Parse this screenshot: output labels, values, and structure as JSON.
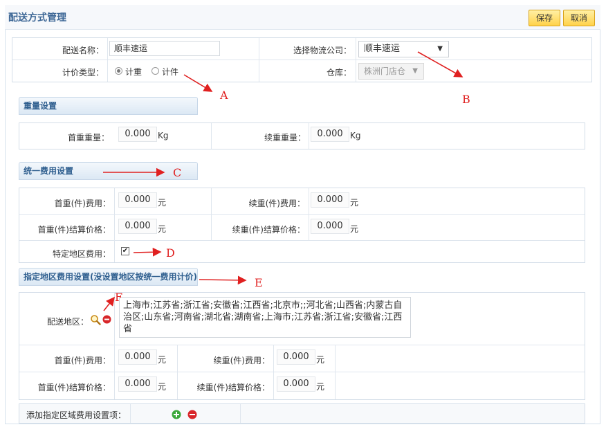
{
  "header": {
    "title": "配送方式管理",
    "save_label": "保存",
    "cancel_label": "取消"
  },
  "basic": {
    "name_label": "配送名称：",
    "name_value": "顺丰速运",
    "company_label": "选择物流公司：",
    "company_value": "顺丰速运",
    "pricing_label": "计价类型：",
    "pricing_options": [
      "计重",
      "计件"
    ],
    "pricing_selected": "计重",
    "warehouse_label": "仓库：",
    "warehouse_value": "株洲门店仓"
  },
  "weight_section": {
    "title": "重量设置",
    "first_label": "首重重量：",
    "first_value": "0.000",
    "first_unit": "Kg",
    "next_label": "续重重量：",
    "next_value": "0.000",
    "next_unit": "Kg"
  },
  "uniform_section": {
    "title": "统一费用设置",
    "first_fee_label": "首重(件)费用：",
    "first_fee_value": "0.000",
    "first_fee_unit": "元",
    "next_fee_label": "续重(件)费用：",
    "next_fee_value": "0.000",
    "next_fee_unit": "元",
    "first_settle_label": "首重(件)结算价格：",
    "first_settle_value": "0.000",
    "first_settle_unit": "元",
    "next_settle_label": "续重(件)结算价格：",
    "next_settle_value": "0.000",
    "next_settle_unit": "元",
    "special_label": "特定地区费用：",
    "special_checked": true
  },
  "region_section": {
    "title": "指定地区费用设置(没设置地区按统一费用计价)",
    "area_label": "配送地区：",
    "area_text": "上海市;江苏省;浙江省;安徽省;江西省;北京市;;河北省;山西省;内蒙古自治区;山东省;河南省;湖北省;湖南省;上海市;江苏省;浙江省;安徽省;江西省",
    "first_fee_label": "首重(件)费用：",
    "first_fee_value": "0.000",
    "first_fee_unit": "元",
    "next_fee_label": "续重(件)费用：",
    "next_fee_value": "0.000",
    "next_fee_unit": "元",
    "first_settle_label": "首重(件)结算价格：",
    "first_settle_value": "0.000",
    "first_settle_unit": "元",
    "next_settle_label": "续重(件)结算价格：",
    "next_settle_value": "0.000",
    "next_settle_unit": "元",
    "add_label": "添加指定区域费用设置项："
  },
  "annotations": {
    "a": "A",
    "b": "B",
    "c": "C",
    "d": "D",
    "e": "E",
    "f": "F"
  },
  "colors": {
    "accent": "#3d6796",
    "annotation": "#e02020",
    "button": "#ffd24a"
  }
}
